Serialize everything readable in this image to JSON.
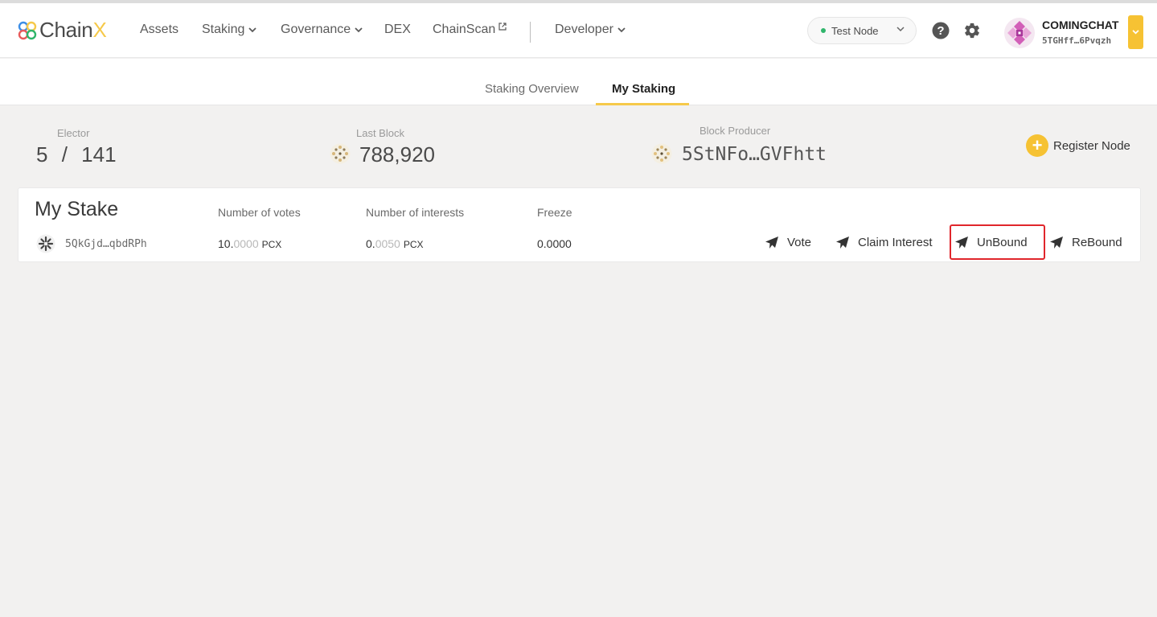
{
  "brand": {
    "name_main": "Chain",
    "name_accent": "X"
  },
  "nav": {
    "assets": "Assets",
    "staking": "Staking",
    "governance": "Governance",
    "dex": "DEX",
    "chainscan": "ChainScan",
    "developer": "Developer"
  },
  "node": {
    "label": "Test Node",
    "status_color": "#2fb56b"
  },
  "account": {
    "name": "COMINGCHAT",
    "address": "5TGHff…6Pvqzh"
  },
  "tabs": {
    "overview": "Staking Overview",
    "my_staking": "My Staking",
    "active": "my_staking"
  },
  "stats": {
    "elector_label": "Elector",
    "elector_current": "5",
    "elector_sep": "/",
    "elector_total": "141",
    "last_block_label": "Last Block",
    "last_block_value": "788,920",
    "producer_label": "Block Producer",
    "producer_value": "5StNFo…GVFhtt"
  },
  "register": {
    "label": "Register Node"
  },
  "stake": {
    "title": "My Stake",
    "columns": {
      "votes": "Number of votes",
      "interests": "Number of interests",
      "freeze": "Freeze"
    },
    "row": {
      "address": "5QkGjd…qbdRPh",
      "votes_int": "10.",
      "votes_dec": "0000",
      "votes_unit": "PCX",
      "interests_int": "0.",
      "interests_dec": "0050",
      "interests_unit": "PCX",
      "freeze": "0.0000"
    },
    "actions": {
      "vote": "Vote",
      "claim": "Claim Interest",
      "unbound": "UnBound",
      "rebound": "ReBound"
    }
  },
  "colors": {
    "accent": "#f6c233",
    "highlight": "#e0262c"
  },
  "icons": [
    "chainx-logo-icon",
    "chevron-down-icon",
    "external-link-icon",
    "help-icon",
    "gear-icon",
    "identicon",
    "plus-icon",
    "send-icon"
  ]
}
